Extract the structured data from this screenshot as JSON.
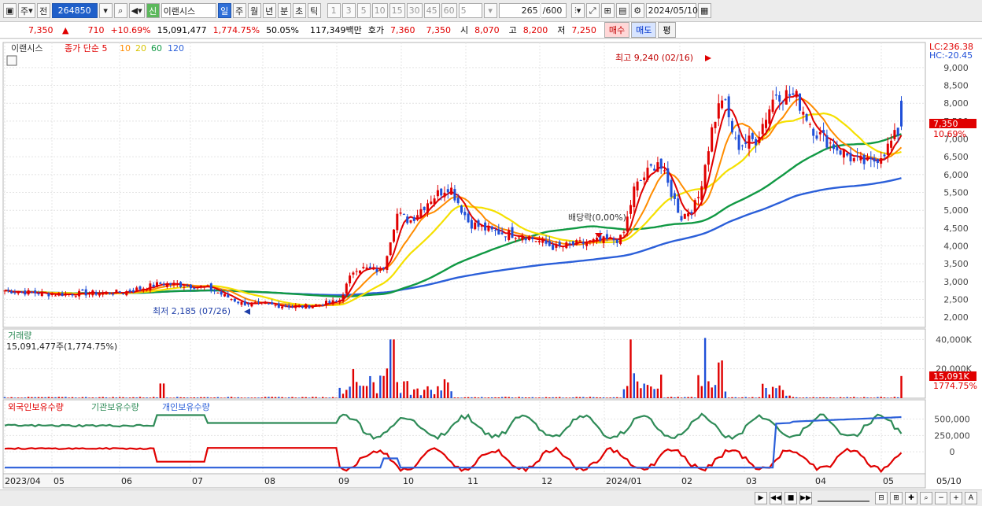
{
  "toolbar": {
    "market_code": "주",
    "prev_label": "전",
    "stock_code": "264850",
    "credit_badge": "신",
    "stock_name": "이랜시스",
    "periods": [
      "일",
      "주",
      "월",
      "년",
      "분",
      "초",
      "틱"
    ],
    "active_period": "일",
    "intervals": [
      "1",
      "3",
      "5",
      "10",
      "15",
      "30",
      "45",
      "60"
    ],
    "interval_value": "5",
    "bar_count": "265",
    "bar_total": "/600",
    "date": "2024/05/10"
  },
  "quote": {
    "price": "7,350",
    "change_arrow": "▲",
    "change": "710",
    "change_pct": "+10.69%",
    "volume": "15,091,477",
    "volume_pct": "1,774.75%",
    "ratio": "50.05%",
    "amount": "117,349백만",
    "ask_label": "호가",
    "ask": "7,360",
    "bid": "7,350",
    "open_label": "시",
    "open": "8,070",
    "high_label": "고",
    "high": "8,200",
    "low_label": "저",
    "low": "7,250",
    "buy_label": "매수",
    "sell_label": "매도",
    "eval_label": "평"
  },
  "colors": {
    "up": "#e00000",
    "down": "#1f4fd8",
    "ma5": "#e00000",
    "ma10": "#ff8c00",
    "ma20": "#f5e000",
    "ma60": "#119944",
    "ma120": "#2b5fd9",
    "foreign": "#e00000",
    "institution": "#2e8b57",
    "individual": "#2b5fd9"
  },
  "chart_data": [
    {
      "type": "candlestick",
      "title": "이랜시스",
      "legend": [
        "종가 단순 5",
        "10",
        "20",
        "60",
        "120"
      ],
      "y_ticks": [
        "9,000",
        "8,500",
        "8,000",
        "7,500",
        "7,000",
        "6,500",
        "6,000",
        "5,500",
        "5,000",
        "4,500",
        "4,000",
        "3,500",
        "3,000",
        "2,500",
        "2,000"
      ],
      "ylim": [
        1850,
        9350
      ],
      "x_labels": [
        "2023/04",
        "05",
        "06",
        "07",
        "08",
        "09",
        "10",
        "11",
        "12",
        "2024/01",
        "02",
        "03",
        "04",
        "05",
        "05/10"
      ],
      "annotations": {
        "high": "최고 9,240 (02/16)",
        "low": "최저 2,185 (07/26)",
        "dividend": "배당락(0,00%)",
        "lc": "LC:236.38",
        "hc": "HC:-20.45",
        "last_price": "7,350",
        "last_pct": "10.69%"
      },
      "key_points": [
        {
          "date": "2023/04",
          "close": 2750
        },
        {
          "date": "2023/06",
          "close": 2900
        },
        {
          "date": "2023/07/26",
          "low": 2185
        },
        {
          "date": "2023/08",
          "close": 2350
        },
        {
          "date": "2023/09",
          "close": 3500
        },
        {
          "date": "2023/10",
          "close": 5300
        },
        {
          "date": "2023/11",
          "close": 4500
        },
        {
          "date": "2023/12",
          "close": 3950
        },
        {
          "date": "2024/01",
          "close": 5800
        },
        {
          "date": "2024/02/16",
          "high": 9240
        },
        {
          "date": "2024/03",
          "close": 7800
        },
        {
          "date": "2024/04",
          "close": 6500
        },
        {
          "date": "2024/05/10",
          "open": 8070,
          "high": 8200,
          "low": 7250,
          "close": 7350
        }
      ],
      "ma_last": {
        "ma5": 6850,
        "ma10": 6700,
        "ma20": 6550,
        "ma60": 7150,
        "ma120": 5950
      }
    },
    {
      "type": "bar",
      "title": "거래량",
      "value_label": "15,091,477주(1,774.75%)",
      "y_ticks": [
        "40,000K",
        "20,000K"
      ],
      "last_label": "15,091K",
      "last_pct": "1774.75%"
    },
    {
      "type": "line",
      "legend": [
        "외국인보유수량",
        "기관보유수량",
        "개인보유수량"
      ],
      "y_ticks": [
        "500,000",
        "250,000",
        "0"
      ]
    }
  ]
}
